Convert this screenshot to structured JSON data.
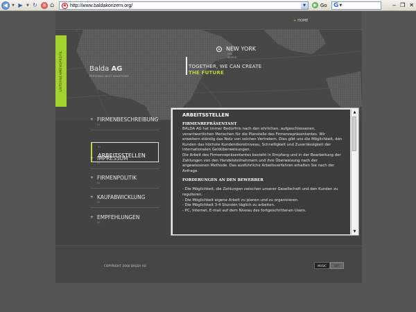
{
  "browser": {
    "url": "http://www.baldakonzern.org/",
    "go_label": "Go",
    "search_icon": "G"
  },
  "site": {
    "home_link": "HOME",
    "side_tag": "UNTERNEHMENSPROFIL",
    "brand_name": "Balda",
    "brand_suffix": "AG",
    "brand_sub": "PERSONAL BEST SOLUTIONS",
    "location_title": "NEW YORK",
    "location_sub1": "THE",
    "location_sub2": "WORLD",
    "slogan_line1": "TOGETHER, WE CAN CREATE",
    "slogan_line2": "THE FUTURE"
  },
  "nav": {
    "items": [
      {
        "label": "FIRMENBESCHREIBUNG",
        "sub": "01"
      },
      {
        "label": "ARBEITSSTELLEN",
        "sub": "02"
      },
      {
        "label": "IMPRESSUM",
        "sub": "03"
      },
      {
        "label": "FIRMENPOLITIK",
        "sub": "04"
      },
      {
        "label": "KAUFABWICKLUNG",
        "sub": "05"
      },
      {
        "label": "EMPFEHLUNGEN",
        "sub": "06"
      }
    ]
  },
  "panel": {
    "title": "ARBEITSSTELLEN",
    "h1": "FIRMENREPRÄSENTANT",
    "p1": "BALDA AG hat immer Bedürfnis nach den ehrlichen, aufgeschlossenen, verantwortlichen Menschen für die Planstelle des Firmenrepräsentantes. Wir erweitern ständig das Netz von solchen Vertretern. Dies gibt uns die Möglichkeit, den Kunden das höchste Kundendienstniveau, Schnelligkeit und Zuverlässigkeit der internationalen Geldüberweisungen.",
    "p2": "Die Arbeit des Firmenrepräsentantes besteht in Empfang und in der Bearbeitung der Zahlungen von den Handelsteilnehmern und ihre Überweisung nach der angewiesenen Methode. Das ausführliche Arbeitsverfahren erhalten Sie nach der Anfrage.",
    "h2": "FORDERUNGEN AN DEN BEWERBER",
    "bullets": [
      "- Die Möglichkeit, die Zahlungen zwischen unserer Gesellschaft und den Kunden zu regulieren.",
      "- Die Möglichkeit eigene Arbeit zu planen und zu organisieren.",
      "- Die Möglichkeit 3-4 Stunden täglich zu arbeiten.",
      "- PC, Internet, E-mail auf dem Niveau des fortgeschrittenen Users."
    ]
  },
  "footer": {
    "copyright": "COPYRIGHT 2006 BALDA AG",
    "music_label": "MUSIC",
    "music_state": "OFF"
  }
}
